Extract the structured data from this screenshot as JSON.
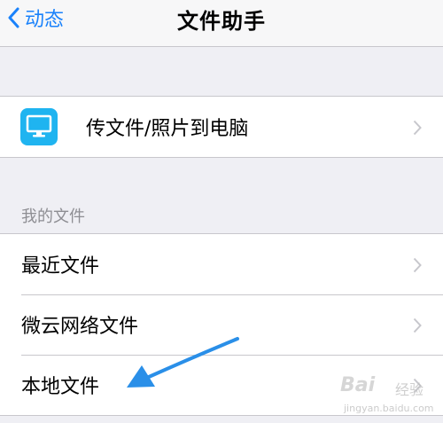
{
  "navbar": {
    "back_label": "动态",
    "title": "文件助手"
  },
  "transfer": {
    "label": "传文件/照片到电脑",
    "icon": "monitor-icon"
  },
  "my_files": {
    "header": "我的文件",
    "items": [
      {
        "label": "最近文件"
      },
      {
        "label": "微云网络文件"
      },
      {
        "label": "本地文件"
      }
    ]
  },
  "colors": {
    "accent": "#1a82fb",
    "icon_bg": "#1fb4f0",
    "background": "#efeff4",
    "annotation_arrow": "#2a8fe8"
  },
  "watermark": {
    "brand": "Bai",
    "product": "经验",
    "url": "jingyan.baidu.com"
  }
}
